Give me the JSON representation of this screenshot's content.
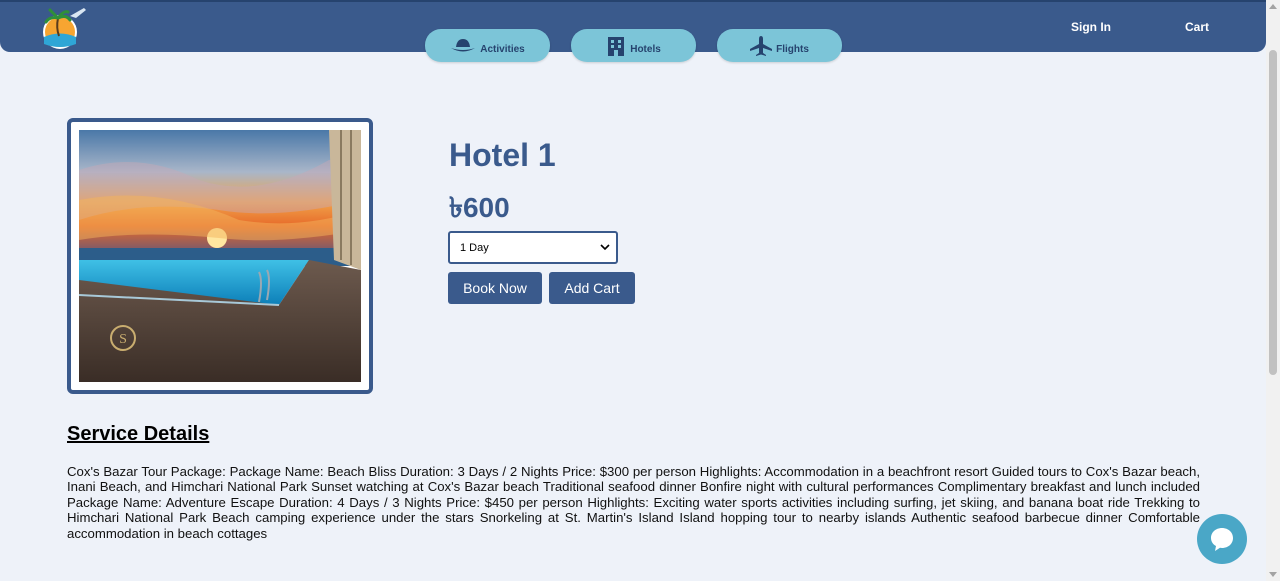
{
  "header": {
    "tabs": [
      {
        "label": "Activities",
        "icon": "hat-icon"
      },
      {
        "label": "Hotels",
        "icon": "building-icon"
      },
      {
        "label": "Flights",
        "icon": "plane-icon"
      }
    ],
    "sign_in": "Sign In",
    "cart": "Cart"
  },
  "hotel": {
    "title": "Hotel 1",
    "price": "৳600",
    "duration_selected": "1 Day",
    "book_label": "Book Now",
    "add_cart_label": "Add Cart"
  },
  "details": {
    "title": "Service Details",
    "text": "Cox's Bazar Tour Package: Package Name: Beach Bliss Duration: 3 Days / 2 Nights Price: $300 per person Highlights: Accommodation in a beachfront resort Guided tours to Cox's Bazar beach, Inani Beach, and Himchari National Park Sunset watching at Cox's Bazar beach Traditional seafood dinner Bonfire night with cultural performances Complimentary breakfast and lunch included Package Name: Adventure Escape Duration: 4 Days / 3 Nights Price: $450 per person Highlights: Exciting water sports activities including surfing, jet skiing, and banana boat ride Trekking to Himchari National Park Beach camping experience under the stars Snorkeling at St. Martin's Island Island hopping tour to nearby islands Authentic seafood barbecue dinner Comfortable accommodation in beach cottages"
  },
  "colors": {
    "nav": "#3a5a8c",
    "tab": "#7cc5d8",
    "accent": "#3a5a8c",
    "chat": "#4aa7c7"
  }
}
